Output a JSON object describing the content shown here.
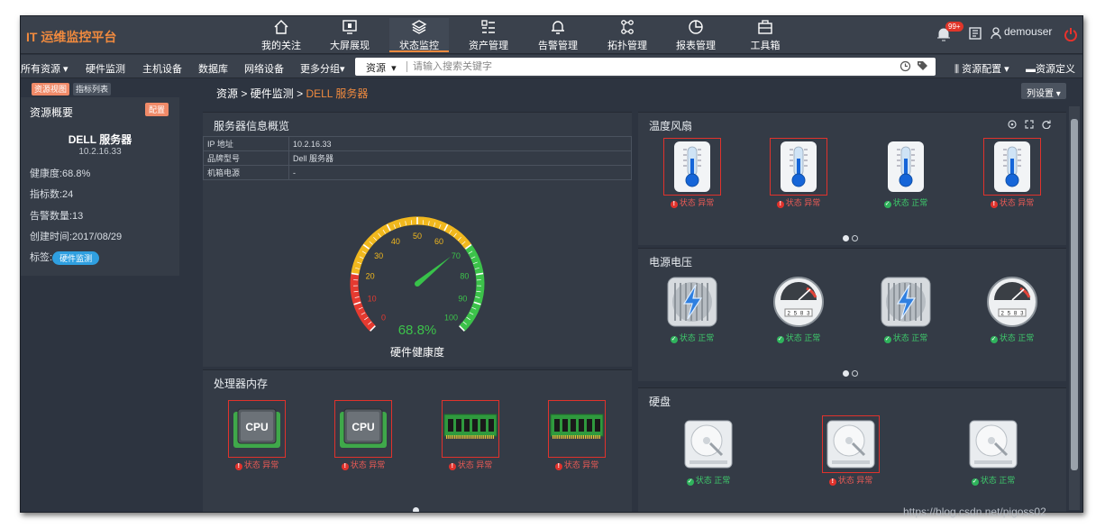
{
  "brand": "IT 运维监控平台",
  "nav": [
    {
      "label": "我的关注",
      "icon": "home-icon"
    },
    {
      "label": "大屏展现",
      "icon": "screen-icon"
    },
    {
      "label": "状态监控",
      "icon": "layers-icon"
    },
    {
      "label": "资产管理",
      "icon": "list-icon"
    },
    {
      "label": "告警管理",
      "icon": "bell-icon"
    },
    {
      "label": "拓扑管理",
      "icon": "topology-icon"
    },
    {
      "label": "报表管理",
      "icon": "pie-chart-icon"
    },
    {
      "label": "工具箱",
      "icon": "toolbox-icon"
    }
  ],
  "user": {
    "notification_count": "99+",
    "username": "demouser"
  },
  "subnav": {
    "categories": [
      "所有资源",
      "硬件监测",
      "主机设备",
      "数据库",
      "网络设备",
      "更多分组"
    ],
    "search_type": "资源",
    "search_placeholder": "请输入搜索关键字",
    "resource_config": "资源配置",
    "resource_define": "资源定义"
  },
  "left": {
    "tab_resource_view": "资源视图",
    "tab_metric_list": "指标列表",
    "title": "资源概要",
    "config_label": "配置",
    "device_name": "DELL 服务器",
    "device_ip": "10.2.16.33",
    "health": "健康度:68.8%",
    "metrics": "指标数:24",
    "alerts": "告警数量:13",
    "created": "创建时间:2017/08/29",
    "tag_label": "标签:",
    "tag": "硬件监测"
  },
  "breadcrumb": {
    "root": "资源",
    "sep": ">",
    "level1": "硬件监测",
    "current": "DELL 服务器"
  },
  "column_settings": "列设置",
  "server_info": {
    "title": "服务器信息概览",
    "rows": [
      {
        "key": "IP 地址",
        "value": "10.2.16.33"
      },
      {
        "key": "品牌型号",
        "value": "Dell 服务器"
      },
      {
        "key": "机箱电源",
        "value": "-"
      }
    ]
  },
  "gauge": {
    "value": 68.8,
    "value_label": "68.8%",
    "title": "硬件健康度",
    "ticks": [
      "0",
      "10",
      "20",
      "30",
      "40",
      "50",
      "60",
      "70",
      "80",
      "90",
      "100"
    ]
  },
  "processor_memory": {
    "title": "处理器内存",
    "items": [
      {
        "kind": "cpu",
        "label": "CPU",
        "status": "状态 异常",
        "ok": false
      },
      {
        "kind": "cpu",
        "label": "CPU",
        "status": "状态 异常",
        "ok": false
      },
      {
        "kind": "memory",
        "label": "",
        "status": "状态 异常",
        "ok": false
      },
      {
        "kind": "memory",
        "label": "",
        "status": "状态 异常",
        "ok": false
      }
    ]
  },
  "temperature_fan": {
    "title": "温度风扇",
    "items": [
      {
        "status": "状态 异常",
        "ok": false
      },
      {
        "status": "状态 异常",
        "ok": false
      },
      {
        "status": "状态 正常",
        "ok": true
      },
      {
        "status": "状态 异常",
        "ok": false
      }
    ]
  },
  "power_voltage": {
    "title": "电源电压",
    "items": [
      {
        "kind": "power",
        "status": "状态 正常",
        "ok": true
      },
      {
        "kind": "meter",
        "status": "状态 正常",
        "ok": true
      },
      {
        "kind": "power",
        "status": "状态 正常",
        "ok": true
      },
      {
        "kind": "meter",
        "status": "状态 正常",
        "ok": true
      }
    ],
    "meter_digits": "2 5 8 3"
  },
  "disk": {
    "title": "硬盘",
    "items": [
      {
        "status": "状态 正常",
        "ok": true
      },
      {
        "status": "状态 异常",
        "ok": false
      },
      {
        "status": "状态 正常",
        "ok": true
      }
    ]
  },
  "colors": {
    "accent": "#f08a3e",
    "bad": "#e85a55",
    "ok": "#3ec86b",
    "gauge_needle": "#38c24a"
  },
  "watermark": "https://blog.csdn.net/pigoss02"
}
